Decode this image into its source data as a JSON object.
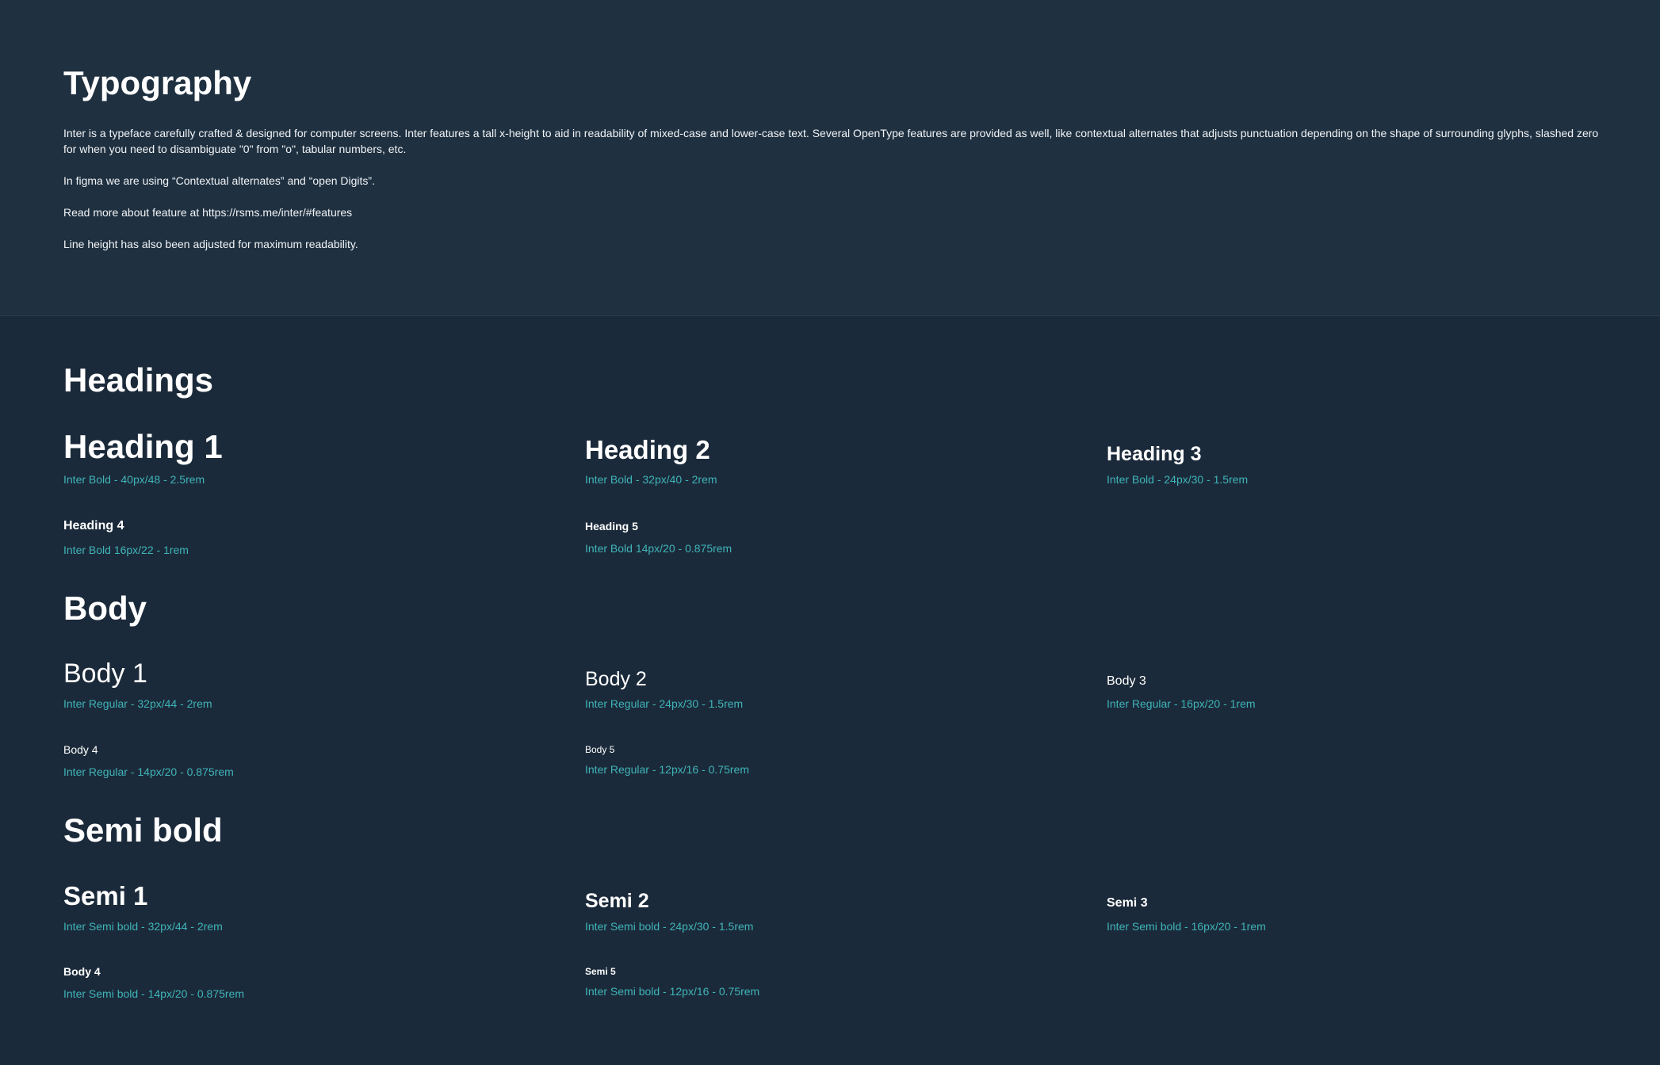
{
  "intro": {
    "title": "Typography",
    "paragraphs": [
      "Inter is a typeface carefully crafted & designed for computer screens. Inter features a tall x-height to aid in readability of mixed-case and lower-case text. Several OpenType features are provided as well, like contextual alternates that adjusts punctuation depending on the shape of surrounding glyphs, slashed zero for when you need to disambiguate \"0\" from \"o\", tabular numbers, etc.",
      "In figma we are using “Contextual alternates” and “open Digits”.",
      "Read more about feature at https://rsms.me/inter/#features",
      "Line height has also been adjusted for maximum readability."
    ]
  },
  "headings": {
    "title": "Headings",
    "h1": {
      "sample": "Heading 1",
      "meta": "Inter Bold - 40px/48 - 2.5rem"
    },
    "h2": {
      "sample": "Heading 2",
      "meta": "Inter Bold - 32px/40 - 2rem"
    },
    "h3": {
      "sample": "Heading 3",
      "meta": "Inter Bold - 24px/30 - 1.5rem"
    },
    "h4": {
      "sample": "Heading 4",
      "meta": "Inter Bold 16px/22 - 1rem"
    },
    "h5": {
      "sample": "Heading 5",
      "meta": "Inter Bold 14px/20 - 0.875rem"
    }
  },
  "body": {
    "title": "Body",
    "b1": {
      "sample": "Body 1",
      "meta": "Inter Regular - 32px/44 - 2rem"
    },
    "b2": {
      "sample": "Body 2",
      "meta": "Inter Regular - 24px/30 - 1.5rem"
    },
    "b3": {
      "sample": "Body 3",
      "meta": "Inter Regular - 16px/20 - 1rem"
    },
    "b4": {
      "sample": "Body 4",
      "meta": "Inter Regular - 14px/20 - 0.875rem"
    },
    "b5": {
      "sample": "Body 5",
      "meta": "Inter Regular - 12px/16 - 0.75rem"
    }
  },
  "semibold": {
    "title": "Semi bold",
    "s1": {
      "sample": "Semi 1",
      "meta": "Inter Semi bold - 32px/44 - 2rem"
    },
    "s2": {
      "sample": "Semi 2",
      "meta": "Inter Semi bold - 24px/30 - 1.5rem"
    },
    "s3": {
      "sample": "Semi 3",
      "meta": "Inter Semi bold - 16px/20 - 1rem"
    },
    "s4": {
      "sample": "Body 4",
      "meta": "Inter Semi bold - 14px/20 - 0.875rem"
    },
    "s5": {
      "sample": "Semi 5",
      "meta": "Inter Semi bold - 12px/16 - 0.75rem"
    }
  },
  "colors": {
    "page_bg": "#1b2a3a",
    "intro_bg": "#1f3040",
    "text": "#ffffff",
    "accent": "#3fb4b8"
  }
}
